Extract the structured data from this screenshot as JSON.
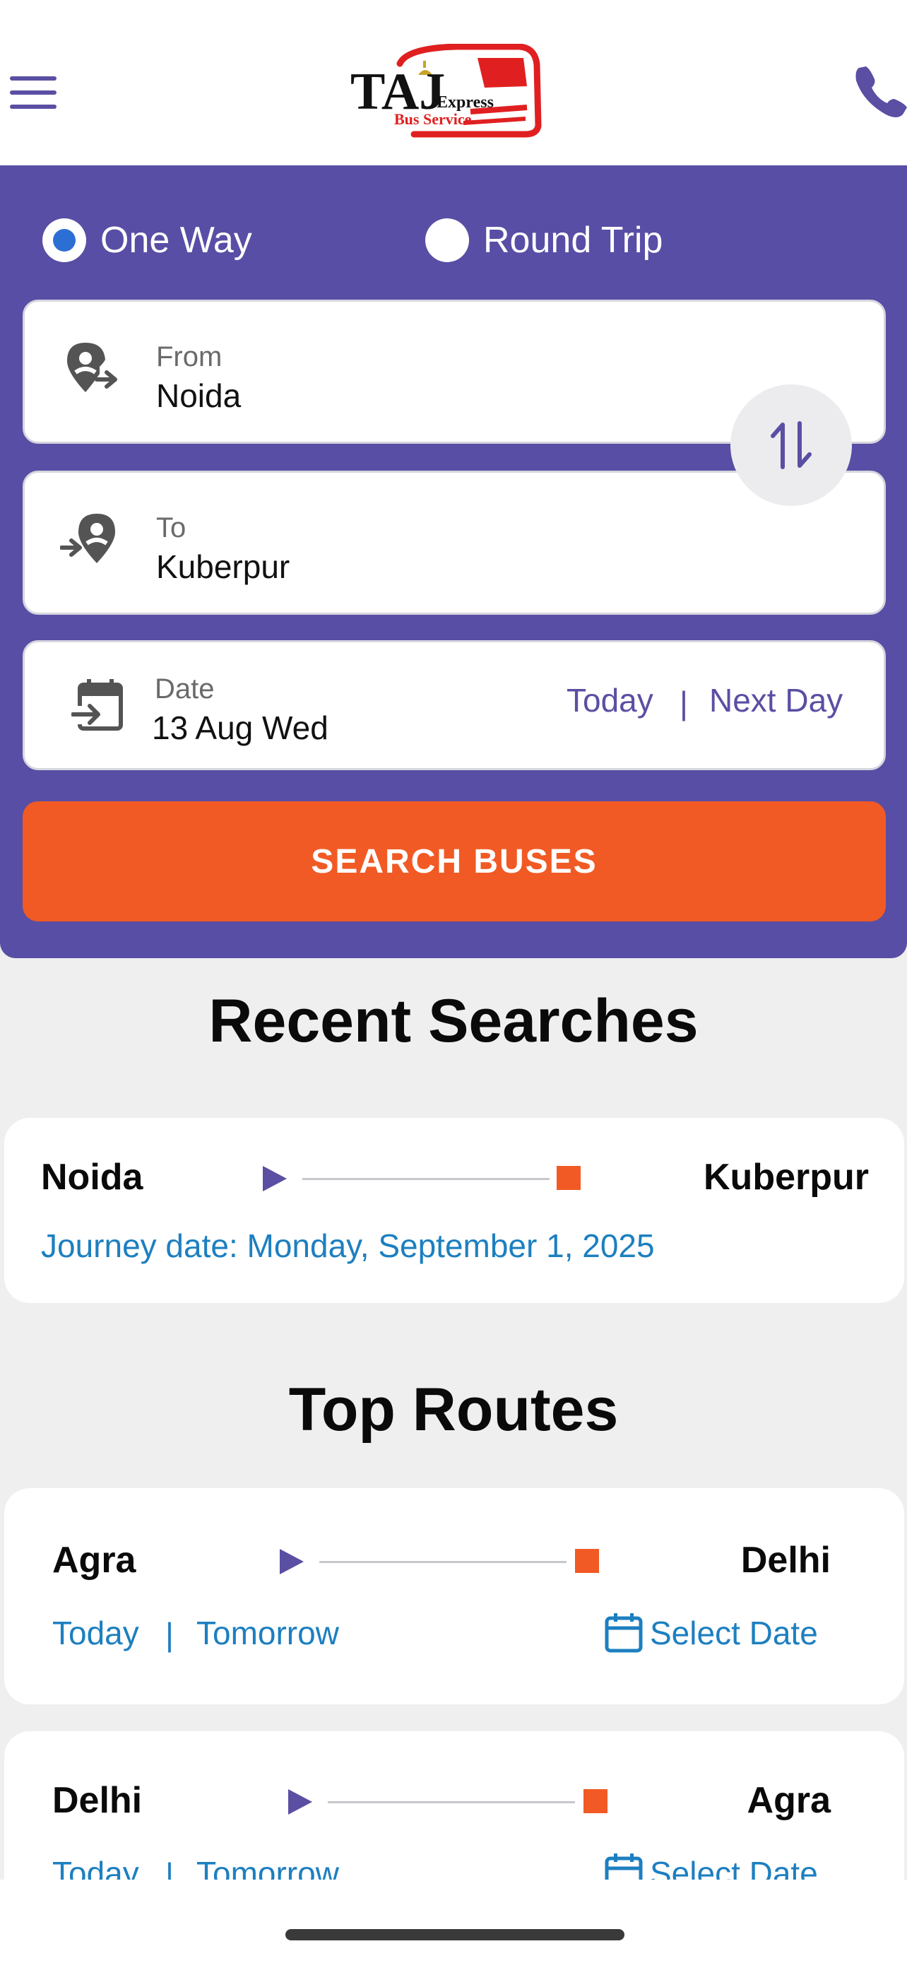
{
  "header": {
    "logo_main": "TAJ",
    "logo_sub1": "Express",
    "logo_sub2": "Bus Service",
    "brand_purple": "#584ea5",
    "brand_orange": "#f15a24"
  },
  "trip_type": {
    "one_way": "One Way",
    "round_trip": "Round Trip",
    "selected": "One Way"
  },
  "from": {
    "label": "From",
    "value": "Noida"
  },
  "to": {
    "label": "To",
    "value": "Kuberpur"
  },
  "date": {
    "label": "Date",
    "value": "13 Aug Wed",
    "today": "Today",
    "separator": "|",
    "next_day": "Next Day"
  },
  "search_button": "SEARCH BUSES",
  "recent": {
    "title": "Recent Searches",
    "items": [
      {
        "from": "Noida",
        "to": "Kuberpur",
        "journey": "Journey date: Monday, September 1, 2025"
      }
    ]
  },
  "top_routes": {
    "title": "Top Routes",
    "items": [
      {
        "from": "Agra",
        "to": "Delhi",
        "today": "Today",
        "sep": "|",
        "tomorrow": "Tomorrow",
        "select_date": "Select Date"
      },
      {
        "from": "Delhi",
        "to": "Agra",
        "today": "Today",
        "sep": "|",
        "tomorrow": "Tomorrow",
        "select_date": "Select Date"
      }
    ]
  }
}
